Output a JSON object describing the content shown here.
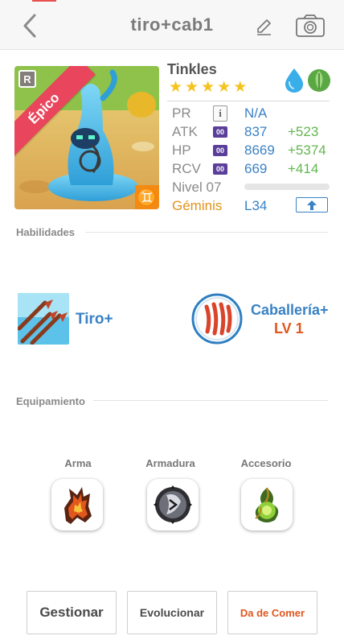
{
  "header": {
    "title": "tiro+cab1",
    "icons": {
      "back": "chevron-left-icon",
      "edit": "pencil-icon",
      "camera": "camera-icon"
    }
  },
  "monster": {
    "name": "Tinkles",
    "rarity_letter": "R",
    "rarity_label": "Épico",
    "zodiac_symbol": "♊",
    "stars": 5,
    "elements": [
      "water-drop-icon",
      "leaf-icon"
    ],
    "stats": {
      "pr": {
        "label": "PR",
        "value": "N/A"
      },
      "atk": {
        "label": "ATK",
        "value": "837",
        "bonus": "+523",
        "icon_text": "00"
      },
      "hp": {
        "label": "HP",
        "value": "8669",
        "bonus": "+5374",
        "icon_text": "00"
      },
      "rcv": {
        "label": "RCV",
        "value": "669",
        "bonus": "+414",
        "icon_text": "00"
      },
      "level": {
        "label": "Nivel 07",
        "progress": 0
      },
      "sign": {
        "label": "Géminis",
        "value": "L34"
      }
    }
  },
  "skills": {
    "header": "Habilidades",
    "active": {
      "name": "Tiro+"
    },
    "leader": {
      "name": "Caballería+",
      "level": "LV 1"
    }
  },
  "equipment": {
    "header": "Equipamiento",
    "slots": [
      {
        "label": "Arma",
        "icon": "flame-weapon-icon"
      },
      {
        "label": "Armadura",
        "icon": "shield-armor-icon"
      },
      {
        "label": "Accesorio",
        "icon": "green-gem-accessory-icon"
      }
    ]
  },
  "actions": {
    "manage": "Gestionar",
    "evolve": "Evolucionar",
    "feed": "Da de Comer"
  },
  "colors": {
    "accent_blue": "#3a82c4",
    "bonus_green": "#62b64e",
    "orange": "#e0571e",
    "epic_ribbon": "#e9455c",
    "zodiac_orange": "#f28a14"
  }
}
